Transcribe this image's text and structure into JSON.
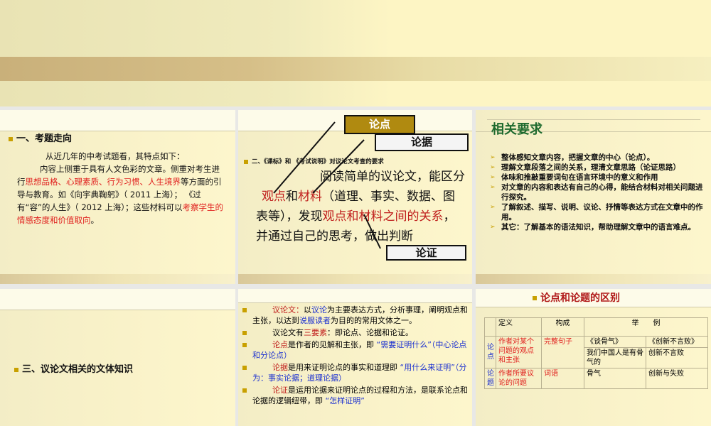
{
  "slide1": {
    "heading": "一、考题走向",
    "line1": "从近几年的中考试题看，其特点如下：",
    "p_a": "内容上侧重于具有人文色彩的文章。侧重对考生进行",
    "p_red1": "思想品格、心理素质、行为习惯、人生境界",
    "p_b": "等方面的引导与教育。如《向宇典鞠躬》（ 2011 上海）； 《过有“容”的人生》（ 2012 上海）；这些材料可以",
    "p_red2": "考察学生的情感态度和价值取向",
    "p_end": "。"
  },
  "slide2": {
    "heading": "二、《课标》和 《考试说明》对议论文考查的要求",
    "t1": "阅读简单的议论文，能区分",
    "r1": "观点",
    "t2": "和",
    "r2": "材料",
    "t3": "（道理、事实、数据、图表等），发现",
    "r3": "观点和材料之间的关系",
    "t4": "，并通过自己的思考，做出判断",
    "tag_lundian": "论点",
    "tag_lunju": "论据",
    "tag_lunzheng": "论证"
  },
  "slide3": {
    "title": "相关要求",
    "items": [
      "整体感知文章内容，把握文章的中心（论点）。",
      "理解文章段落之间的关系，理清文章思路（论证思路）",
      "体味和推敲重要词句在语言环境中的意义和作用",
      "对文章的内容和表达有自己的心得，能结合材料对相关问题进行探究。",
      "了解叙述、描写、说明、议论、抒情等表达方式在文章中的作用。",
      "其它：了解基本的语法知识，帮助理解文章中的语言难点。"
    ]
  },
  "slide4": {
    "heading": "三、议论文相关的文体知识"
  },
  "slide5": {
    "p1": {
      "r": "议论文：",
      "a": "以",
      "b1": "议论",
      "c": "为主要表达方式，分析事理，阐明观点和主张，以达到",
      "b2": "说服读者",
      "d": "为目的的常用文体之一。"
    },
    "p2": {
      "a": "议论文有",
      "r": "三要素",
      "b": "：即论点、论据和论证。"
    },
    "p3": {
      "r": "论点",
      "a": "是作者的见解和主张，即 ",
      "b": "“需要证明什么”（中心论点和分论点）"
    },
    "p4": {
      "r": "论据",
      "a": "是用来证明论点的事实和道理即 ",
      "b": "“用什么来证明”（分为：事实论据；道理论据）"
    },
    "p5": {
      "r": "论证",
      "a": "是运用论据来证明论点的过程和方法，是联系论点和论据的逻辑纽带，即 ",
      "b": "“怎样证明”"
    }
  },
  "slide6": {
    "title": "论点和论题的区别",
    "headers": [
      "定义",
      "构成",
      "举　　例"
    ],
    "ex_titles": [
      "《谈骨气》",
      "《创新不言败》"
    ],
    "rows": [
      {
        "label": "论点",
        "def": "作者对某个问题的观点和主张",
        "form": "完整句子",
        "ex": [
          "我们中国人是有骨气的",
          "创新不言败"
        ]
      },
      {
        "label": "论题",
        "def": "作者所要议论的问题",
        "form": "词语",
        "ex": [
          "骨气",
          "创新与失败"
        ]
      }
    ]
  }
}
